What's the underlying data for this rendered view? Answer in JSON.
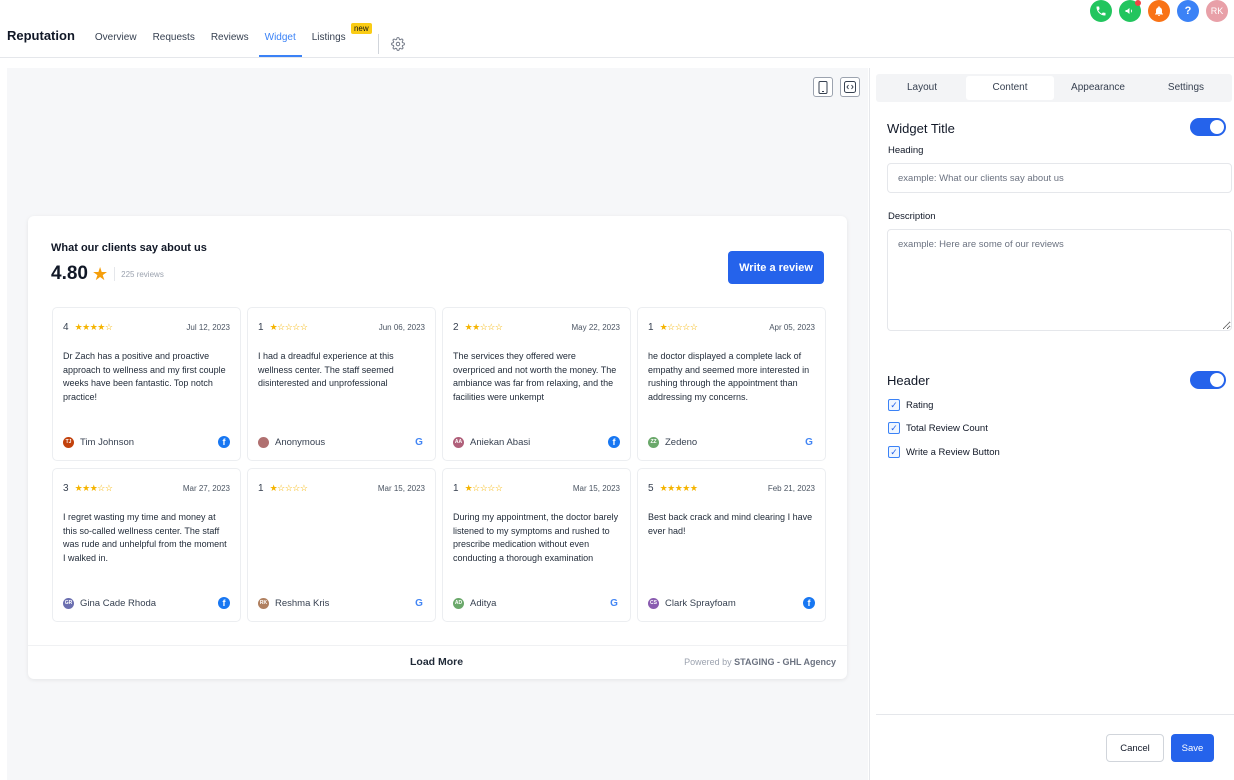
{
  "topbar": {
    "icons": [
      {
        "name": "phone-icon",
        "color": "#22c55e"
      },
      {
        "name": "megaphone-icon",
        "color": "#22c55e"
      },
      {
        "name": "bell-icon",
        "color": "#f97316"
      },
      {
        "name": "help-icon",
        "color": "#3b82f6",
        "label": "?"
      },
      {
        "name": "avatar",
        "color": "#e8a0a8",
        "label": "RK"
      }
    ]
  },
  "nav": {
    "brand": "Reputation",
    "tabs": [
      {
        "label": "Overview"
      },
      {
        "label": "Requests"
      },
      {
        "label": "Reviews"
      },
      {
        "label": "Widget",
        "active": true
      },
      {
        "label": "Listings",
        "badge": "new"
      }
    ]
  },
  "widget": {
    "title": "What our clients say about us",
    "rating": "4.80",
    "review_count": "225 reviews",
    "write_button": "Write a review",
    "load_more": "Load More",
    "powered_prefix": "Powered by ",
    "powered_brand": "STAGING - GHL Agency",
    "reviews": [
      {
        "rating": "4",
        "stars": 4,
        "date": "Jul 12, 2023",
        "text": "Dr Zach has a positive and proactive approach to wellness and my first couple weeks have been fantastic. Top notch practice!",
        "author": "Tim Johnson",
        "initials": "TJ",
        "avatar_color": "#c2410c",
        "source": "facebook"
      },
      {
        "rating": "1",
        "stars": 1,
        "date": "Jun 06, 2023",
        "text": "I had a dreadful experience at this wellness center. The staff seemed disinterested and unprofessional",
        "author": "Anonymous",
        "initials": "",
        "avatar_color": "#b07070",
        "source": "google"
      },
      {
        "rating": "2",
        "stars": 2,
        "date": "May 22, 2023",
        "text": "The services they offered were overpriced and not worth the money. The ambiance was far from relaxing, and the facilities were unkempt",
        "author": "Aniekan Abasi",
        "initials": "AA",
        "avatar_color": "#b0607a",
        "source": "facebook"
      },
      {
        "rating": "1",
        "stars": 1,
        "date": "Apr 05, 2023",
        "text": "he doctor displayed a complete lack of empathy and seemed more interested in rushing through the appointment than addressing my concerns.",
        "author": "Zedeno",
        "initials": "ZZ",
        "avatar_color": "#6aa86a",
        "source": "google"
      },
      {
        "rating": "3",
        "stars": 3,
        "date": "Mar 27, 2023",
        "text": "I regret wasting my time and money at this so-called wellness center. The staff was rude and unhelpful from the moment I walked in.",
        "author": "Gina Cade Rhoda",
        "initials": "GR",
        "avatar_color": "#6b6fb0",
        "source": "facebook"
      },
      {
        "rating": "1",
        "stars": 1,
        "date": "Mar 15, 2023",
        "text": "",
        "author": "Reshma Kris",
        "initials": "RK",
        "avatar_color": "#b08060",
        "source": "google"
      },
      {
        "rating": "1",
        "stars": 1,
        "date": "Mar 15, 2023",
        "text": "During my appointment, the doctor barely listened to my symptoms and rushed to prescribe medication without even conducting a thorough examination",
        "author": "Aditya",
        "initials": "AD",
        "avatar_color": "#6aa86a",
        "source": "google"
      },
      {
        "rating": "5",
        "stars": 5,
        "date": "Feb 21, 2023",
        "text": "Best back crack and mind clearing I have ever had!",
        "author": "Clark Sprayfoam",
        "initials": "CS",
        "avatar_color": "#8a5cb0",
        "source": "facebook"
      }
    ]
  },
  "panel": {
    "tabs": [
      {
        "label": "Layout"
      },
      {
        "label": "Content",
        "active": true
      },
      {
        "label": "Appearance"
      },
      {
        "label": "Settings"
      }
    ],
    "widget_title_section": "Widget Title",
    "heading_label": "Heading",
    "heading_placeholder": "example: What our clients say about us",
    "description_label": "Description",
    "description_placeholder": "example: Here are some of our reviews",
    "header_section": "Header",
    "checkboxes": [
      {
        "label": "Rating",
        "checked": true
      },
      {
        "label": "Total Review Count",
        "checked": true
      },
      {
        "label": "Write a Review Button",
        "checked": true
      }
    ],
    "cancel": "Cancel",
    "save": "Save"
  }
}
